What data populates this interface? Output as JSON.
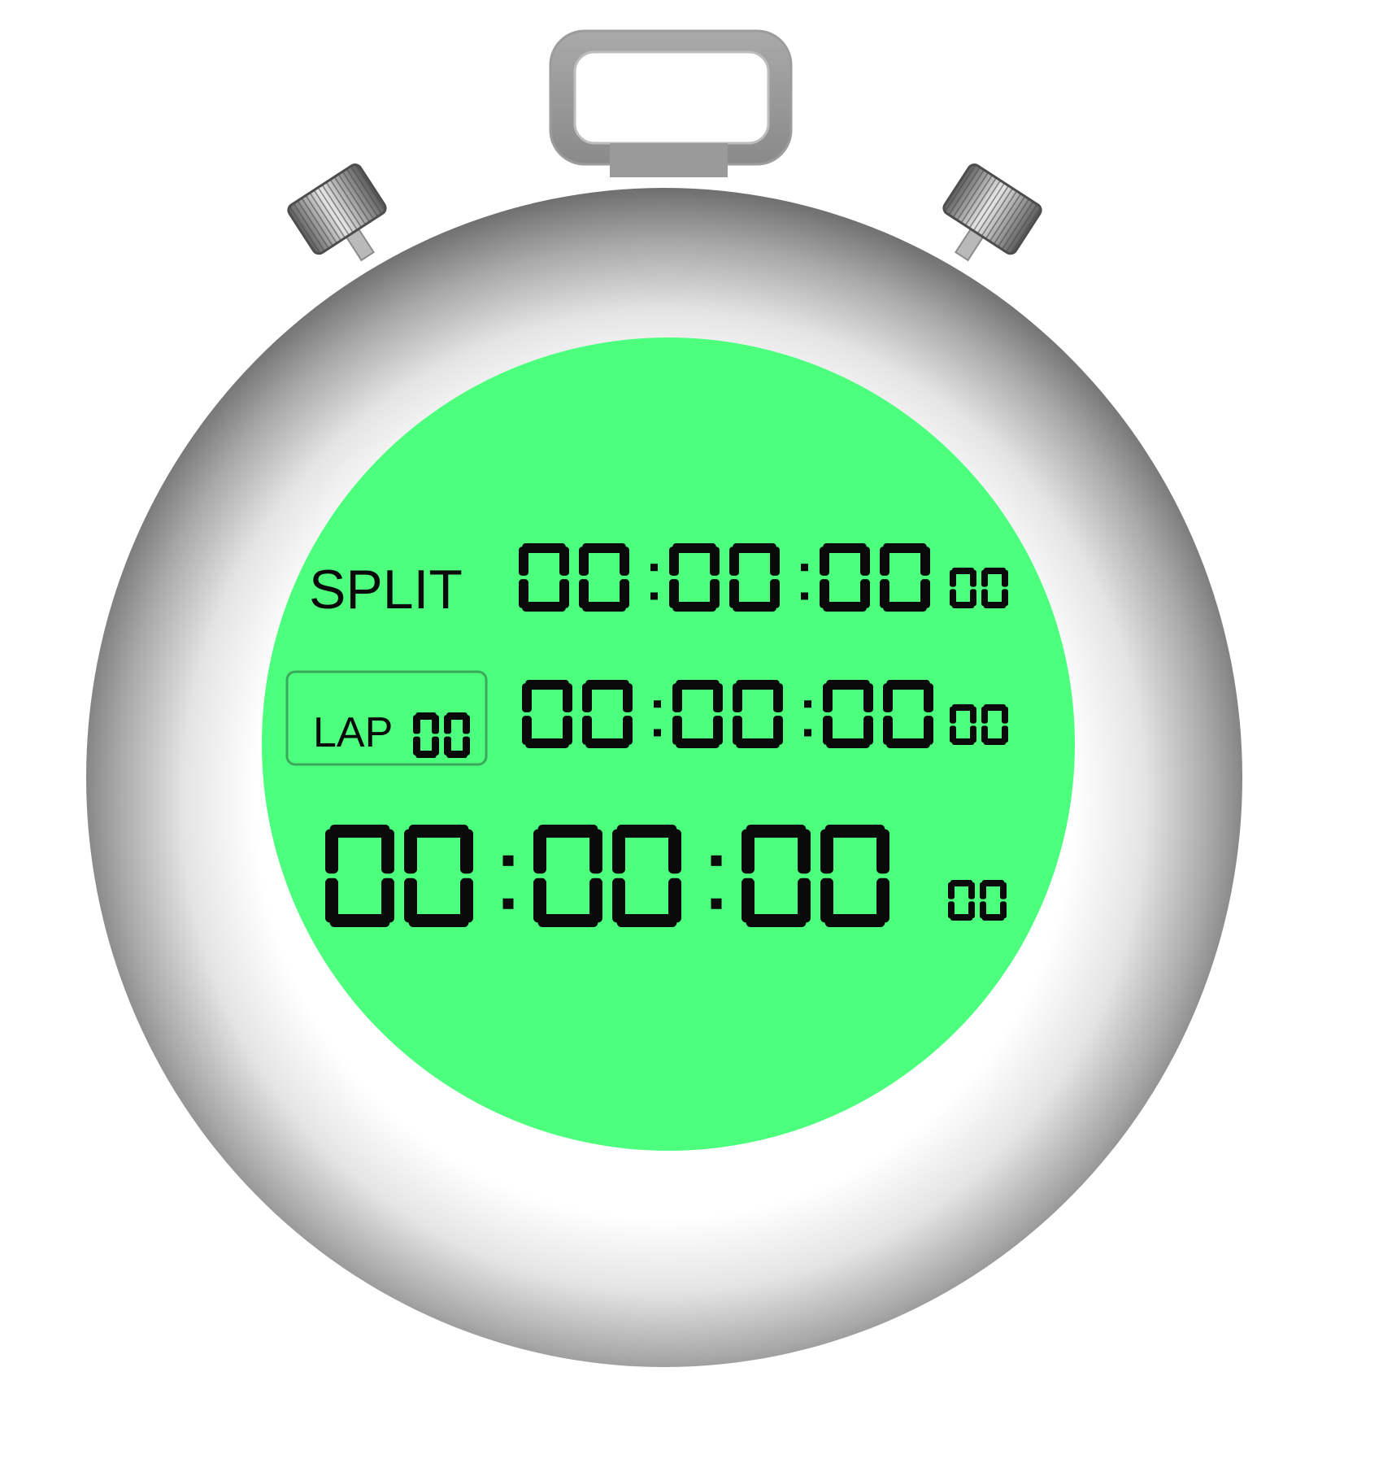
{
  "colors": {
    "lcd": "#4cff7d",
    "digit": "#0a0a0a",
    "metal_light": "#ffffff",
    "metal_dark": "#6f6f6f",
    "knob": "#8a8a8a"
  },
  "display": {
    "split": {
      "label": "SPLIT",
      "hours": "00",
      "minutes": "00",
      "seconds": "00",
      "hundredths": "00"
    },
    "lap": {
      "label": "LAP",
      "count": "00",
      "hours": "00",
      "minutes": "00",
      "seconds": "00",
      "hundredths": "00"
    },
    "main": {
      "hours": "00",
      "minutes": "00",
      "seconds": "00",
      "hundredths": "00"
    }
  },
  "icons": {
    "top_loop": "stopwatch-loop-icon",
    "left_button": "left-crown-button-icon",
    "right_button": "right-crown-button-icon"
  }
}
